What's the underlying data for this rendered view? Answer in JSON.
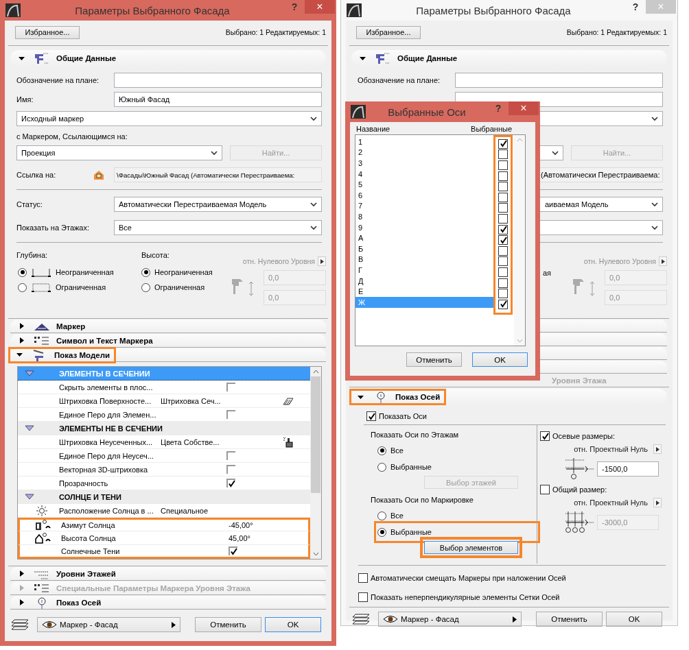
{
  "left_dialog": {
    "title": "Параметры Выбранного Фасада",
    "active": true,
    "help": "?",
    "close": "×",
    "favorites": "Избранное...",
    "selection_info": "Выбрано: 1 Редактируемых: 1",
    "general": {
      "kind": "general",
      "title": "Общие Данные",
      "expanded": true,
      "plan_label": "Обозначение на плане:",
      "name_label": "Имя:",
      "name_value": "Южный Фасад",
      "marker_select": "Исходный маркер",
      "ref_label": "с Маркером, Ссылающимся на:",
      "ref_select": "Проекция",
      "find_button": {
        "label": "Найти...",
        "disabled": true
      },
      "link_label": "Ссылка на:",
      "link_value": "\\Фасады\\Южный Фасад (Автоматически Перестраиваема:",
      "status_label": "Статус:",
      "status_value": "Автоматически Перестраиваемая Модель",
      "floors_label": "Показать на Этажах:",
      "floors_value": "Все",
      "depth": {
        "label": "Глубина:",
        "options": [
          {
            "label": "Неограниченная",
            "selected": true
          },
          {
            "label": "Ограниченная",
            "selected": false
          }
        ]
      },
      "height": {
        "label": "Высота:",
        "options": [
          {
            "label": "Неограниченная",
            "selected": true
          },
          {
            "label": "Ограниченная",
            "selected": false
          }
        ]
      },
      "ref_level": "отн. Нулевого Уровня",
      "levels": [
        "0,0",
        "0,0"
      ]
    },
    "sections_before": [
      {
        "kind": "marker",
        "title": "Маркер",
        "expanded": false,
        "disabled": false
      },
      {
        "kind": "symbol",
        "title": "Символ и Текст Маркера",
        "expanded": false,
        "disabled": false
      }
    ],
    "model_display": {
      "kind": "model",
      "title": "Показ Модели",
      "expanded": true,
      "disabled": false,
      "highlighted": true,
      "rows": [
        {
          "kind": "group",
          "label": "ЭЛЕМЕНТЫ В СЕЧЕНИИ",
          "expanded": true,
          "selected": true
        },
        {
          "kind": "check",
          "label": "Скрыть элементы в плос...",
          "checked": false,
          "selected": false
        },
        {
          "kind": "hatch",
          "label": "Штриховка Поверхносте...",
          "value": "Штриховка Сеч...",
          "selected": false
        },
        {
          "kind": "check",
          "label": "Единое Перо для Элемен...",
          "checked": false,
          "selected": false
        },
        {
          "kind": "group",
          "label": "ЭЛЕМЕНТЫ НЕ В СЕЧЕНИИ",
          "expanded": true,
          "selected": false
        },
        {
          "kind": "paint",
          "label": "Штриховка Неусеченных...",
          "value": "Цвета Собстве...",
          "selected": false
        },
        {
          "kind": "check",
          "label": "Единое Перо для Неусеч...",
          "checked": false,
          "selected": false
        },
        {
          "kind": "check",
          "label": "Векторная 3D-штриховка",
          "checked": false,
          "selected": false
        },
        {
          "kind": "check",
          "label": "Прозрачность",
          "checked": true,
          "selected": false
        },
        {
          "kind": "group",
          "label": "СОЛНЦЕ И ТЕНИ",
          "expanded": true,
          "selected": false
        },
        {
          "kind": "sun",
          "label": "Расположение Солнца в ...",
          "value": "Специальное",
          "selected": false
        },
        {
          "kind": "azimuth",
          "label": "Азимут Солнца",
          "value": "-45,00°",
          "selected": false,
          "highlighted": true
        },
        {
          "kind": "altitude",
          "label": "Высота Солнца",
          "value": "45,00°",
          "selected": false,
          "highlighted": true
        },
        {
          "kind": "check",
          "label": "Солнечные Тени",
          "checked": true,
          "selected": false,
          "highlighted": true
        }
      ]
    },
    "sections_after": [
      {
        "kind": "levels",
        "title": "Уровни Этажей",
        "expanded": false,
        "disabled": false
      },
      {
        "kind": "symbol",
        "title": "Специальные Параметры Маркера Уровня Этажа",
        "expanded": false,
        "disabled": true
      },
      {
        "kind": "axes",
        "title": "Показ Осей",
        "expanded": false,
        "disabled": false
      }
    ],
    "footer": {
      "view_select": "Маркер - Фасад",
      "cancel": "Отменить",
      "ok": "OK",
      "ok_default": true
    }
  },
  "right_dialog": {
    "title": "Параметры Выбранного Фасада",
    "active": false,
    "help": "?",
    "close": "×",
    "favorites": "Избранное...",
    "selection_info": "Выбрано: 1 Редактируемых: 1",
    "general": {
      "kind": "general",
      "title": "Общие Данные",
      "expanded": true,
      "plan_label": "Обозначение на плане:",
      "find_button": {
        "label": "Найти...",
        "disabled": true
      },
      "link_value": "(Автоматически Перестраиваема:",
      "status_value": "аиваемая Модель",
      "height_tail": "ая",
      "ref_level": "отн. Нулевого Уровня",
      "levels": [
        "0,0",
        "0,0"
      ]
    },
    "partial_section": {
      "title": "Уровня Этажа",
      "disabled": true
    },
    "axes": {
      "kind": "axes",
      "title": "Показ Осей",
      "expanded": true,
      "disabled": false,
      "highlighted": true,
      "show_axes": {
        "label": "Показать Оси",
        "checked": true
      },
      "by_floors": {
        "title": "Показать Оси по Этажам",
        "options": [
          {
            "label": "Все",
            "selected": true
          },
          {
            "label": "Выбранные",
            "selected": false
          }
        ],
        "button": {
          "label": "Выбор этажей",
          "disabled": true,
          "highlighted": false
        }
      },
      "by_marking": {
        "title": "Показать Оси по Маркировке",
        "options": [
          {
            "label": "Все",
            "selected": false
          },
          {
            "label": "Выбранные",
            "selected": true,
            "highlighted": true
          }
        ],
        "button": {
          "label": "Выбор элементов",
          "disabled": false,
          "highlighted": true
        }
      },
      "axis_dims": {
        "label": "Осевые размеры:",
        "checked": true,
        "ref": "отн. Проектный Нуль",
        "value": "-1500,0",
        "disabled": false
      },
      "total_dim": {
        "label": "Общий размер:",
        "checked": false,
        "ref": "отн. Проектный Нуль",
        "value": "-3000,0",
        "disabled": true
      },
      "options": [
        {
          "label": "Автоматически смещать Маркеры при наложении Осей",
          "checked": false
        },
        {
          "label": "Показать неперпендикулярные элементы Сетки Осей",
          "checked": false
        }
      ]
    },
    "footer": {
      "view_select": "Маркер - Фасад",
      "cancel": "Отменить",
      "ok": "OK",
      "ok_default": false
    }
  },
  "popup": {
    "title": "Выбранные Оси",
    "help": "?",
    "close": "×",
    "columns": [
      "Название",
      "Выбранные"
    ],
    "highlight_checks": true,
    "rows": [
      {
        "label": "1",
        "checked": true,
        "selected": false
      },
      {
        "label": "2",
        "checked": false,
        "selected": false
      },
      {
        "label": "3",
        "checked": false,
        "selected": false
      },
      {
        "label": "4",
        "checked": false,
        "selected": false
      },
      {
        "label": "5",
        "checked": false,
        "selected": false
      },
      {
        "label": "6",
        "checked": false,
        "selected": false
      },
      {
        "label": "7",
        "checked": false,
        "selected": false
      },
      {
        "label": "8",
        "checked": false,
        "selected": false
      },
      {
        "label": "9",
        "checked": true,
        "selected": false
      },
      {
        "label": "А",
        "checked": true,
        "selected": false
      },
      {
        "label": "Б",
        "checked": false,
        "selected": false
      },
      {
        "label": "В",
        "checked": false,
        "selected": false
      },
      {
        "label": "Г",
        "checked": false,
        "selected": false
      },
      {
        "label": "Д",
        "checked": false,
        "selected": false
      },
      {
        "label": "Е",
        "checked": false,
        "selected": false
      },
      {
        "label": "Ж",
        "checked": true,
        "selected": true
      }
    ],
    "cancel": "Отменить",
    "ok": "OK"
  }
}
